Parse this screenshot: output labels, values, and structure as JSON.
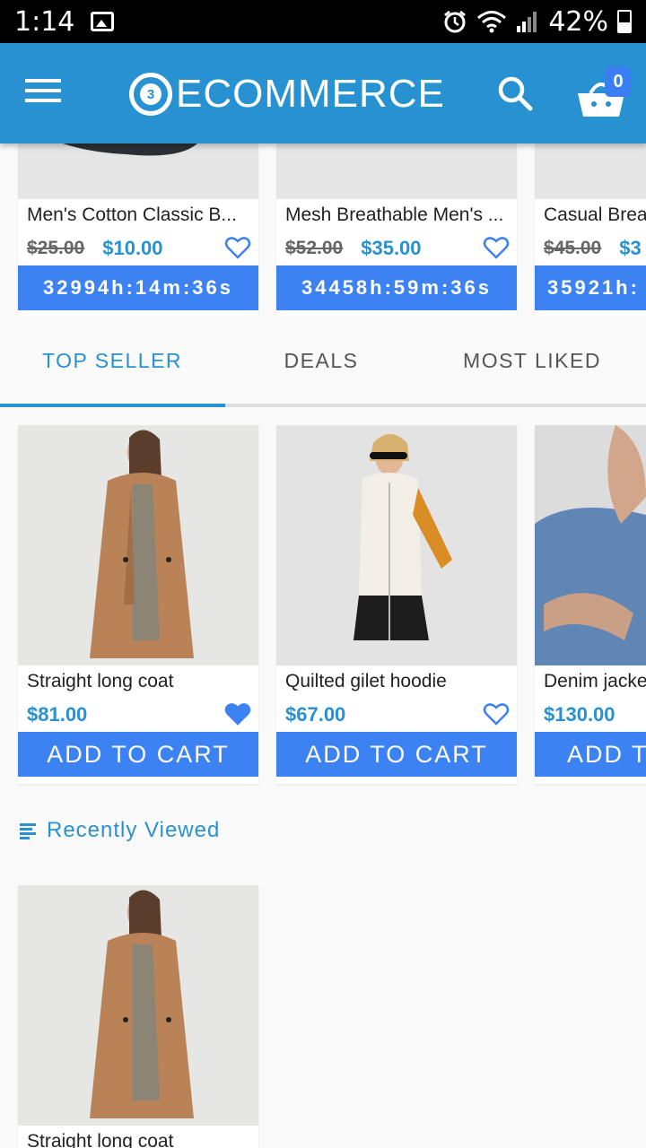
{
  "status_bar": {
    "time": "1:14",
    "battery": "42%"
  },
  "app_bar": {
    "logo_text": "ECOMMERCE",
    "logo_badge": "3",
    "cart_count": "0"
  },
  "flash_deals": [
    {
      "name": "Men's Cotton Classic B...",
      "old_price": "$25.00",
      "new_price": "$10.00",
      "timer": "32994h:14m:36s",
      "liked": false
    },
    {
      "name": "Mesh Breathable Men's ...",
      "old_price": "$52.00",
      "new_price": "$35.00",
      "timer": "34458h:59m:36s",
      "liked": false
    },
    {
      "name": "Casual Brea",
      "old_price": "$45.00",
      "new_price": "$3",
      "timer": "35921h:",
      "liked": false
    }
  ],
  "tabs": [
    {
      "label": "TOP SELLER",
      "active": true
    },
    {
      "label": "DEALS",
      "active": false
    },
    {
      "label": "MOST LIKED",
      "active": false
    }
  ],
  "top_seller": [
    {
      "name": "Straight long coat",
      "price": "$81.00",
      "button": "ADD TO CART",
      "liked": true
    },
    {
      "name": "Quilted gilet hoodie",
      "price": "$67.00",
      "button": "ADD TO CART",
      "liked": false
    },
    {
      "name": "Denim jacke",
      "price": "$130.00",
      "button": "ADD T",
      "liked": false
    }
  ],
  "recently_viewed": {
    "title": "Recently Viewed",
    "items": [
      {
        "name": "Straight long coat"
      }
    ]
  },
  "colors": {
    "primary": "#2891d1",
    "button": "#3d82f3",
    "status_bar": "#000000"
  }
}
